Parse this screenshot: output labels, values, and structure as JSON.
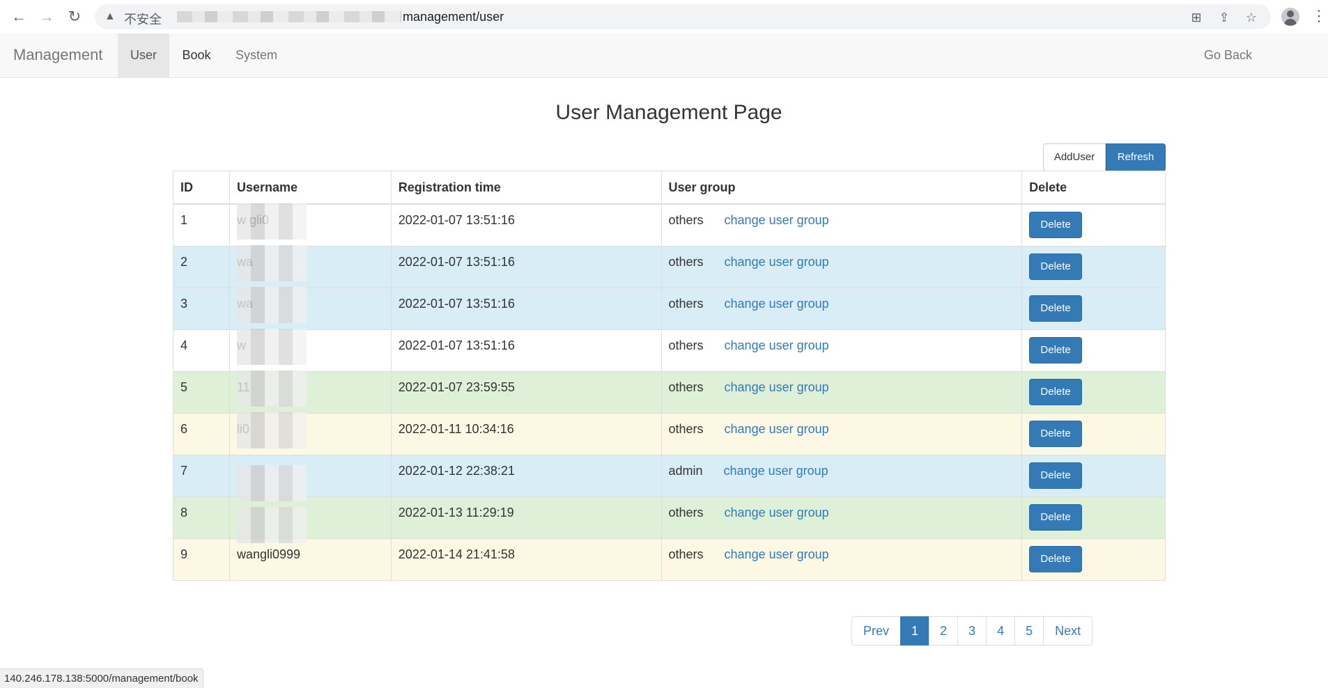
{
  "browser": {
    "insecure_label": "不安全",
    "url_visible": "management/user",
    "status_url": "140.246.178.138:5000/management/book"
  },
  "navbar": {
    "brand": "Management",
    "items": [
      {
        "label": "User",
        "active": true
      },
      {
        "label": "Book",
        "active": false
      },
      {
        "label": "System",
        "active": false
      }
    ],
    "go_back": "Go Back"
  },
  "page": {
    "title": "User Management Page",
    "add_user_label": "AddUser",
    "refresh_label": "Refresh"
  },
  "table": {
    "headers": [
      "ID",
      "Username",
      "Registration time",
      "User group",
      "Delete"
    ],
    "link_label": "change user group",
    "delete_label": "Delete",
    "rows": [
      {
        "id": "1",
        "username": "w gli0",
        "registration_time": "2022-01-07 13:51:16",
        "group": "others",
        "style": "default"
      },
      {
        "id": "2",
        "username": "wa",
        "registration_time": "2022-01-07 13:51:16",
        "group": "others",
        "style": "info"
      },
      {
        "id": "3",
        "username": "wa",
        "registration_time": "2022-01-07 13:51:16",
        "group": "others",
        "style": "info"
      },
      {
        "id": "4",
        "username": "w",
        "registration_time": "2022-01-07 13:51:16",
        "group": "others",
        "style": "default"
      },
      {
        "id": "5",
        "username": "11",
        "registration_time": "2022-01-07 23:59:55",
        "group": "others",
        "style": "success"
      },
      {
        "id": "6",
        "username": "li0",
        "registration_time": "2022-01-11 10:34:16",
        "group": "others",
        "style": "warning"
      },
      {
        "id": "7",
        "username": "",
        "registration_time": "2022-01-12 22:38:21",
        "group": "admin",
        "style": "info"
      },
      {
        "id": "8",
        "username": "",
        "registration_time": "2022-01-13 11:29:19",
        "group": "others",
        "style": "success"
      },
      {
        "id": "9",
        "username": "wangli0999",
        "registration_time": "2022-01-14 21:41:58",
        "group": "others",
        "style": "warning"
      }
    ]
  },
  "pagination": {
    "prev": "Prev",
    "pages": [
      "1",
      "2",
      "3",
      "4",
      "5"
    ],
    "current": "1",
    "next": "Next"
  },
  "colors": {
    "primary": "#337ab7",
    "row_info": "#d9edf7",
    "row_success": "#dff0d8",
    "row_warning": "#fcf8e3"
  }
}
